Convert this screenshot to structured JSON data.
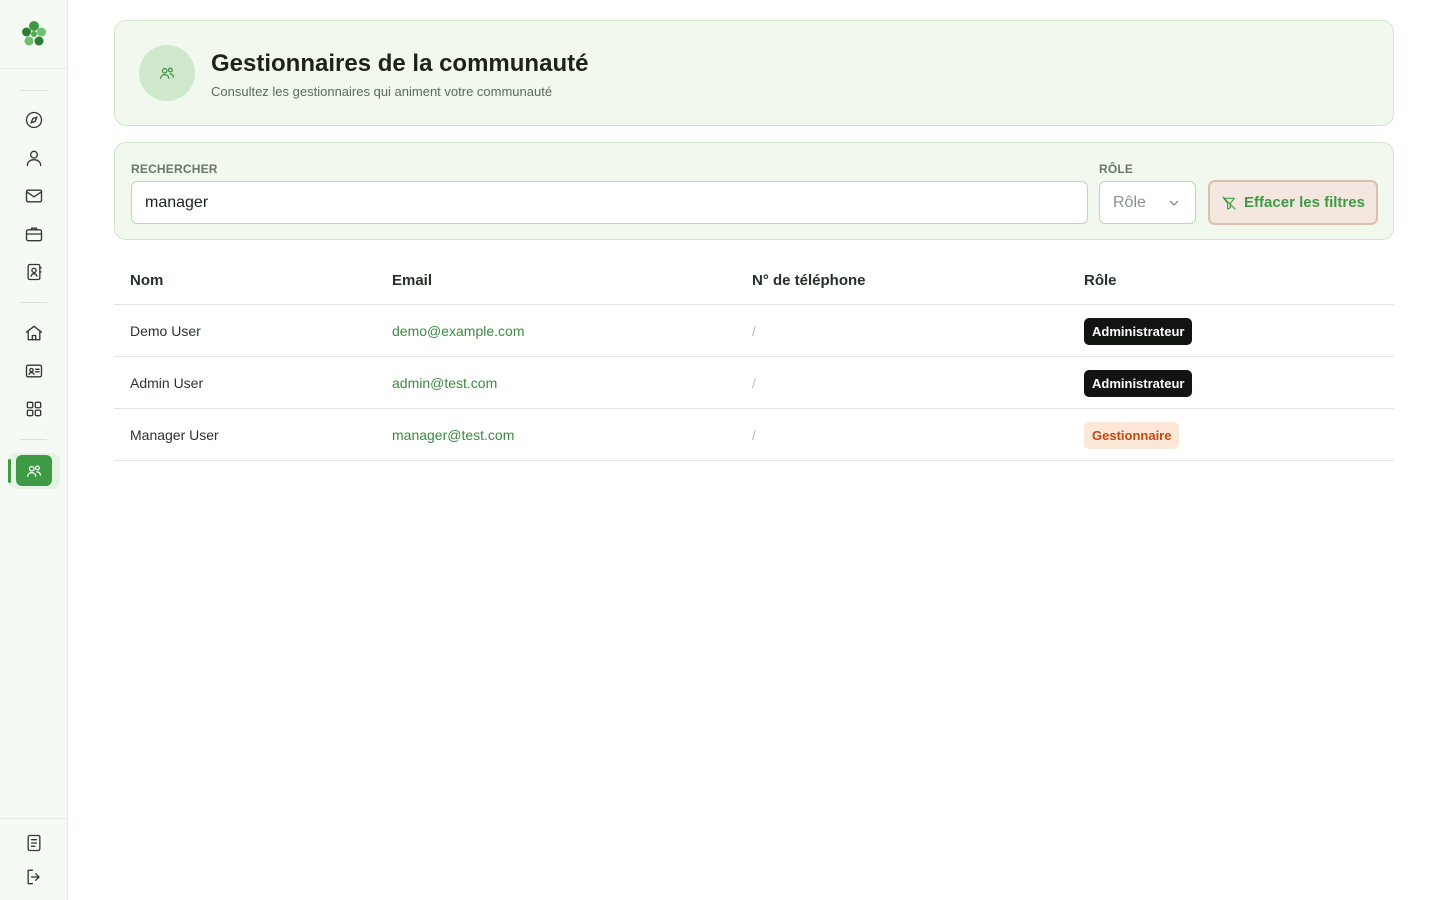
{
  "header": {
    "title": "Gestionnaires de la communauté",
    "subtitle": "Consultez les gestionnaires qui animent votre communauté"
  },
  "filters": {
    "search_label": "RECHERCHER",
    "search_value": "manager",
    "role_label": "RÔLE",
    "role_value": "Rôle",
    "clear_label": "Effacer les filtres"
  },
  "table": {
    "columns": [
      "Nom",
      "Email",
      "N° de téléphone",
      "Rôle"
    ],
    "rows": [
      {
        "name": "Demo User",
        "email": "demo@example.com",
        "phone": "/",
        "role": "Administrateur",
        "role_kind": "admin"
      },
      {
        "name": "Admin User",
        "email": "admin@test.com",
        "phone": "/",
        "role": "Administrateur",
        "role_kind": "admin"
      },
      {
        "name": "Manager User",
        "email": "manager@test.com",
        "phone": "/",
        "role": "Gestionnaire",
        "role_kind": "manager"
      }
    ]
  },
  "sidebar": {
    "items": [
      "compass-icon",
      "user-icon",
      "mail-icon",
      "briefcase-icon",
      "contact-book-icon",
      "home-icon",
      "id-card-icon",
      "grid-icon",
      "community-managers-icon"
    ],
    "footer": [
      "document-icon",
      "logout-icon"
    ]
  },
  "colors": {
    "accent": "#3f9a45",
    "card_bg": "#f1f9ef",
    "admin_badge": "#121412",
    "manager_badge_bg": "#fde7d6",
    "manager_badge_text": "#c24a12"
  }
}
